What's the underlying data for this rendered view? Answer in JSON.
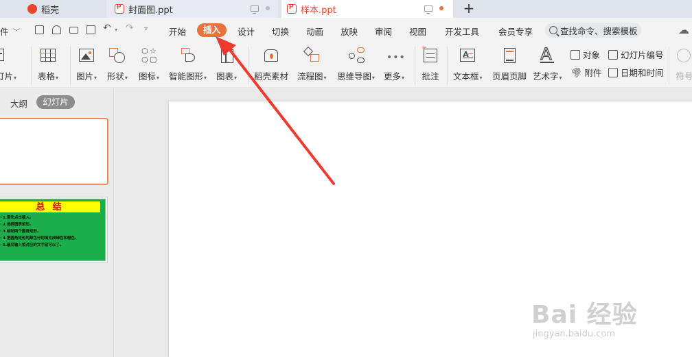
{
  "tabs": [
    {
      "label": "稻壳"
    },
    {
      "label": "封面图.ppt"
    },
    {
      "label": "样本.ppt"
    }
  ],
  "tab_add": "+",
  "menu": {
    "file": "件",
    "items": [
      "开始",
      "插入",
      "设计",
      "切换",
      "动画",
      "放映",
      "审阅",
      "视图",
      "开发工具",
      "会员专享"
    ],
    "active": "插入",
    "search_placeholder": "查找命令、搜索模板"
  },
  "ribbon": {
    "slide": "灯片",
    "table": "表格",
    "picture": "图片",
    "shape": "形状",
    "icon": "图标",
    "smartart": "智能图形",
    "chart": "图表",
    "docer_material": "稻壳素材",
    "flowchart": "流程图",
    "mindmap": "思维导图",
    "more": "更多",
    "comment": "批注",
    "textbox": "文本框",
    "header_footer": "页眉页脚",
    "wordart": "艺术字",
    "object": "对象",
    "attachment": "附件",
    "slide_number": "幻灯片编号",
    "datetime": "日期和时间",
    "symbol": "符号"
  },
  "left_panel": {
    "outline_tab": "大纲",
    "slides_tab": "幻灯片",
    "thumb2_title": "总 结",
    "thumb2_lines": [
      "· 1.首先点击插入。",
      "· 2.选择图表矩形。",
      "· 3.绘制两个圆角矩形。",
      "· 4.把圆角矩形的颜色分别填充成绿色和橙色。",
      "· 5.最后输入相对应的文字就可以了。"
    ]
  },
  "watermark": {
    "main": "Bai 经验",
    "sub": "jingyan.baidu.com"
  },
  "colors": {
    "accent": "#e8743b",
    "arrow": "#f03a2e",
    "tab_active_text": "#e8452c",
    "thumb2_bg": "#1cae4a",
    "thumb2_title_bg": "#ffff00",
    "thumb2_title_text": "#e00000"
  }
}
